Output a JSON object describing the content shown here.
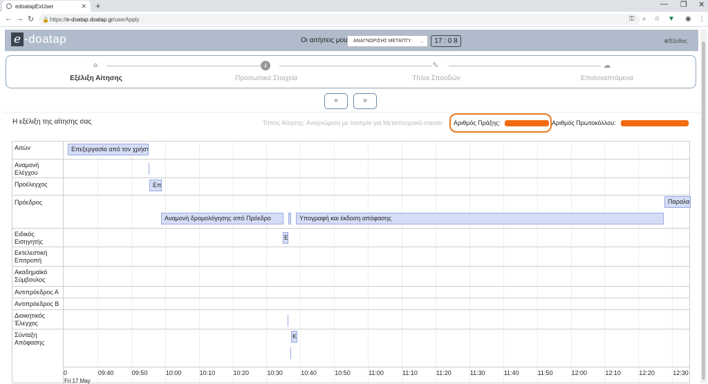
{
  "browser": {
    "tab_title": "edoatapExUser",
    "url_scheme": "https://",
    "url_host": "e-doatap.doatap.gr",
    "url_path": "/userApply"
  },
  "header": {
    "logo_e": "e",
    "logo_text": "-doatap",
    "my_apps_label": "Οι αιτήσεις μου",
    "app_select_value": "ΑΝΑΓΝΩΡΙΣΗΣ ΜΕΤΑΠΤΥ",
    "timer": "17 : 0 8",
    "logout": "Έξοδος"
  },
  "steps": [
    {
      "label": "Εξέλιξη Αίτησης",
      "icon": "search-icon"
    },
    {
      "label": "Προσωπικά Στοιχεία",
      "icon": "info-icon"
    },
    {
      "label": "Τίτλοι Σπουδών",
      "icon": "edit-icon"
    },
    {
      "label": "Επισυναπτόμενα",
      "icon": "cloud-upload-icon"
    }
  ],
  "nav": {
    "prev": "«",
    "next": "»"
  },
  "info": {
    "progress_title": "Η εξέλιξη της αίτησης σας",
    "type_text": "Τύπος Αίτησης: Αναγνώριση με Ισοτιμία για Μεταπτυχιακό-master",
    "act_no_label": "Αριθμός Πράξης:",
    "protocol_label": "Αριθμός Πρωτοκόλλου:"
  },
  "timeline": {
    "rows": [
      "Αιτών",
      "Αναμονή Ελέγχου",
      "Προέλεγχος",
      "Πρόεδρος",
      "Ειδικός Εισηγητής",
      "Εκτελεστική Επιτροπή",
      "Ακαδημαϊκό Σύμβουλος",
      "Αντιπρόεδρος Α",
      "Αντιπρόεδρος Β",
      "Διοικητικός Έλεγχος",
      "Σύνταξη Απόφασης"
    ],
    "bars": {
      "applicant": "Επεξεργασία από τον χρήστη",
      "precheck": "Επ",
      "president_wait": "Αναμονή δρομολόγησης από Πρόεδρο",
      "president_sign": "Υπογραφή και έκδοση απόφασης",
      "president_recv": "Παραλαβή",
      "rapporteur": "Ε",
      "decision": "Κ"
    },
    "ticks": [
      "0",
      "09:40",
      "09:50",
      "10:00",
      "10:10",
      "10:20",
      "10:30",
      "10:40",
      "10:50",
      "11:00",
      "11:10",
      "11:20",
      "11:30",
      "11:40",
      "11:50",
      "12:00",
      "12:10",
      "12:20",
      "12:30"
    ],
    "date_label": "Fri 17 May"
  }
}
